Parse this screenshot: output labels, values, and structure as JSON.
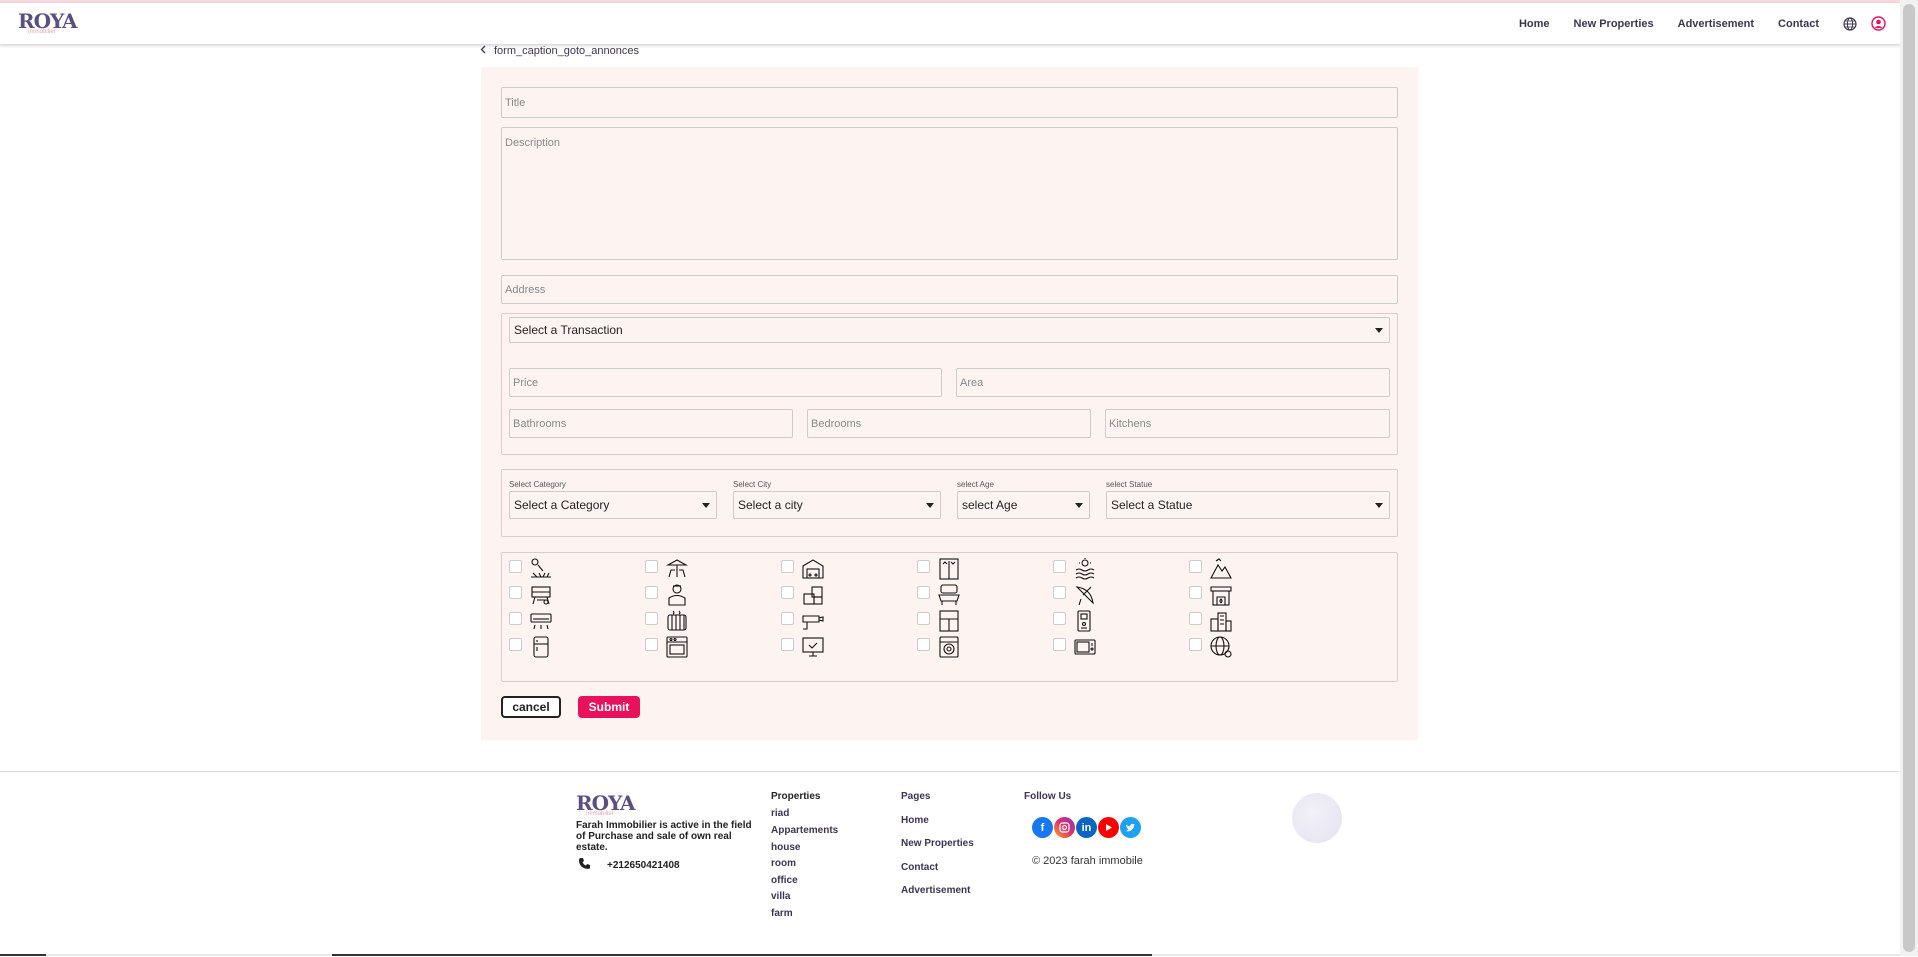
{
  "header": {
    "logo_text": "ROYA",
    "logo_sub": "Immobilier",
    "nav": [
      "Home",
      "New Properties",
      "Advertisement",
      "Contact"
    ],
    "icons": [
      "globe-icon",
      "user-icon"
    ]
  },
  "back_link": "form_caption_goto_annonces",
  "form": {
    "title_placeholder": "Title",
    "description_placeholder": "Description",
    "address_placeholder": "Address",
    "transaction_select": "Select a Transaction",
    "price_placeholder": "Price",
    "area_placeholder": "Area",
    "bathrooms_placeholder": "Bathrooms",
    "bedrooms_placeholder": "Bedrooms",
    "kitchens_placeholder": "Kitchens",
    "category_label": "Select Category",
    "category_select": "Select a Category",
    "city_label": "Select City",
    "city_select": "Select a city",
    "age_label": "select Age",
    "age_select": "select Age",
    "statue_label": "select Statue",
    "statue_select": "Select a Statue",
    "amenity_icons": [
      "garden-icon",
      "terrace-icon",
      "garage-icon",
      "elevator-icon",
      "pool-icon",
      "mountain-view-icon",
      "bbq-icon",
      "concierge-icon",
      "storage-icon",
      "furniture-icon",
      "satellite-dish-icon",
      "fireplace-icon",
      "air-conditioner-icon",
      "heater-icon",
      "security-camera-icon",
      "window-icon",
      "intercom-icon",
      "city-view-icon",
      "fridge-icon",
      "oven-icon",
      "tv-icon",
      "washing-machine-icon",
      "microwave-icon",
      "internet-icon"
    ],
    "cancel_label": "cancel",
    "submit_label": "Submit"
  },
  "footer": {
    "logo_text": "ROYA",
    "logo_sub": "Immobilier",
    "about": "Farah Immobilier is active in the field of Purchase and sale of own real estate.",
    "phone": "+212650421408",
    "properties_heading": "Properties",
    "properties": [
      "riad",
      "Appartements",
      "house",
      "room",
      "office",
      "villa",
      "farm"
    ],
    "pages_heading": "Pages",
    "pages": [
      "Home",
      "New Properties",
      "Contact",
      "Advertisement"
    ],
    "follow_heading": "Follow Us",
    "social": [
      "facebook-icon",
      "instagram-icon",
      "linkedin-icon",
      "youtube-icon",
      "twitter-icon"
    ],
    "copyright": "© 2023 farah immobile"
  },
  "colors": {
    "accent": "#e8115b",
    "brand": "#5a4f82",
    "form_bg": "#fdf4f2"
  }
}
